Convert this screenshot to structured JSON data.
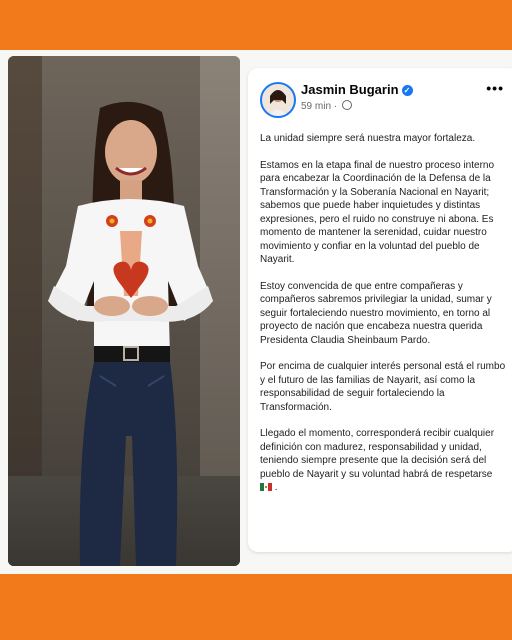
{
  "post": {
    "author": "Jasmin Bugarin",
    "time": "59 min",
    "separator": "·",
    "more": "•••",
    "paragraphs": [
      "La unidad siempre será nuestra mayor fortaleza.",
      "Estamos en la etapa final de nuestro proceso interno para encabezar la Coordinación de la Defensa de la Transformación y la Soberanía Nacional en Nayarit; sabemos que puede haber inquietudes y distintas expresiones, pero el ruido no construye ni abona. Es momento de mantener la serenidad, cuidar nuestro movimiento y confiar en la voluntad del pueblo de Nayarit.",
      "Estoy convencida de que entre compañeras y compañeros sabremos privilegiar la unidad, sumar y seguir fortaleciendo nuestro movimiento, en torno al proyecto de nación que encabeza nuestra querida Presidenta Claudia Sheinbaum Pardo.",
      "Por encima de cualquier interés personal está el rumbo y el futuro de las familias de Nayarit, así como la responsabilidad de seguir fortaleciendo la Transformación.",
      "Llegado el momento, corresponderá recibir cualquier definición con madurez, responsabilidad y unidad, teniendo siempre presente que la decisión será del pueblo de Nayarit y su voluntad habrá de respetarse"
    ],
    "verified_icon": "verified-badge-icon",
    "flag_icon": "mexico-flag-icon"
  },
  "colors": {
    "frame": "#f27a1a",
    "verified": "#1877f2",
    "text": "#1c1e21",
    "meta": "#65676b"
  }
}
